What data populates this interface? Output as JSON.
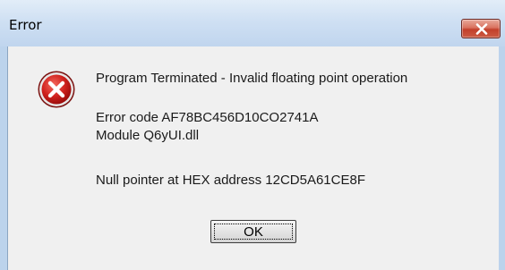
{
  "window": {
    "title": "Error"
  },
  "titlebar": {
    "close_icon": "close-icon"
  },
  "dialog": {
    "icon": "error-icon",
    "message": "Program Terminated - Invalid floating point operation",
    "error_code": "Error code AF78BC456D10CO2741A",
    "module": "Module Q6yUI.dll",
    "null_pointer": "Null pointer at HEX address 12CD5A61CE8F",
    "ok_label": "OK"
  },
  "colors": {
    "titlebar": "#cfe0f3",
    "close_button": "#c2402b",
    "client": "#f0f0f0",
    "error_icon": "#c8161b"
  }
}
